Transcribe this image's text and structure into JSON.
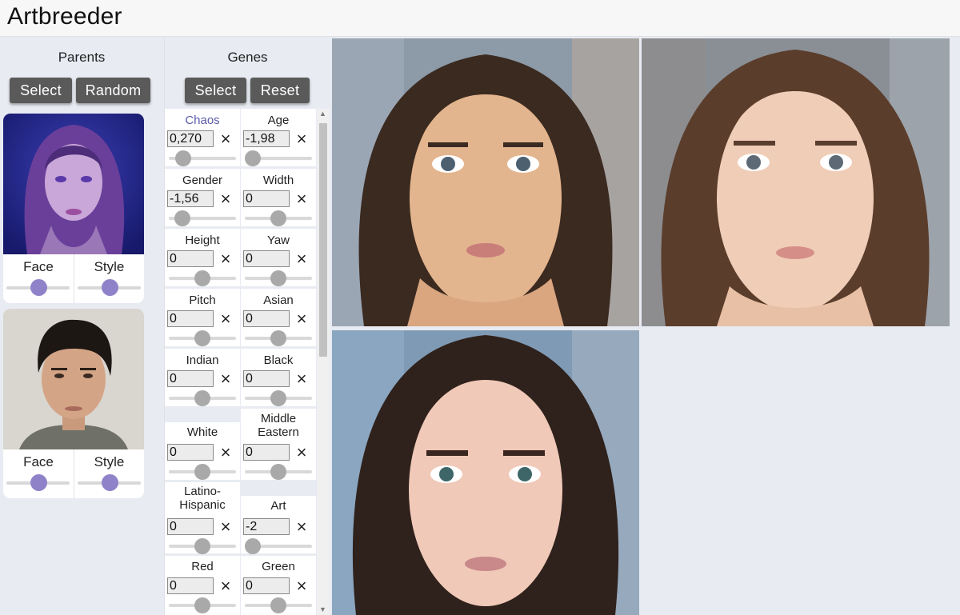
{
  "app": {
    "title": "Artbreeder"
  },
  "parents": {
    "title": "Parents",
    "select_label": "Select",
    "random_label": "Random",
    "cards": [
      {
        "face_label": "Face",
        "style_label": "Style",
        "face_value": 0.5,
        "style_value": 0.5
      },
      {
        "face_label": "Face",
        "style_label": "Style",
        "face_value": 0.5,
        "style_value": 0.5
      }
    ]
  },
  "genes": {
    "title": "Genes",
    "select_label": "Select",
    "reset_label": "Reset",
    "items": [
      {
        "label": "Chaos",
        "value": "0,270",
        "slider": 0.22
      },
      {
        "label": "Age",
        "value": "-1,98",
        "slider": 0.12
      },
      {
        "label": "Gender",
        "value": "-1,56",
        "slider": 0.2
      },
      {
        "label": "Width",
        "value": "0",
        "slider": 0.5
      },
      {
        "label": "Height",
        "value": "0",
        "slider": 0.5
      },
      {
        "label": "Yaw",
        "value": "0",
        "slider": 0.5
      },
      {
        "label": "Pitch",
        "value": "0",
        "slider": 0.5
      },
      {
        "label": "Asian",
        "value": "0",
        "slider": 0.5
      },
      {
        "label": "Indian",
        "value": "0",
        "slider": 0.5
      },
      {
        "label": "Black",
        "value": "0",
        "slider": 0.5
      },
      {
        "label": "White",
        "value": "0",
        "slider": 0.5
      },
      {
        "label_line1": "Middle",
        "label_line2": "Eastern",
        "value": "0",
        "slider": 0.5
      },
      {
        "label_line1": "Latino-",
        "label_line2": "Hispanic",
        "value": "0",
        "slider": 0.5
      },
      {
        "label": "Art",
        "value": "-2",
        "slider": 0.12
      },
      {
        "label": "Red",
        "value": "0",
        "slider": 0.5
      },
      {
        "label": "Green",
        "value": "0",
        "slider": 0.5
      }
    ]
  },
  "colors": {
    "accent_slider": "#8f82c9",
    "button": "#5a5a5a",
    "background": "#e8ebf2"
  }
}
